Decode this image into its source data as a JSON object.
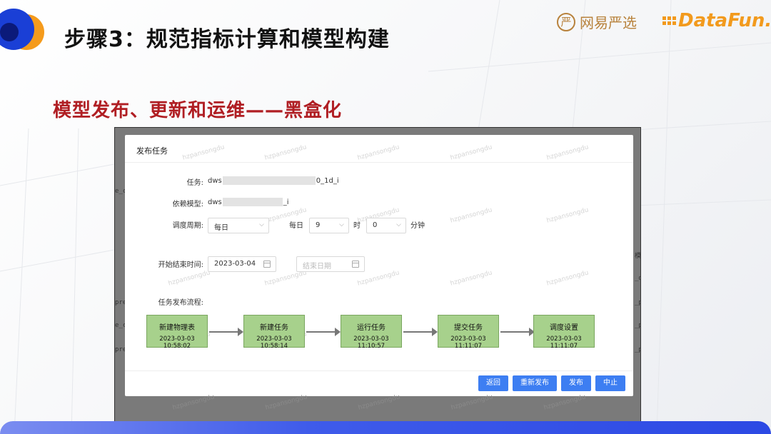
{
  "header": {
    "title": "步骤3：规范指标计算和模型构建",
    "brand_wy": "网易严选",
    "brand_wy_icon": "严",
    "brand_df": "DataFun.",
    "accent_orange": "#f59b1c",
    "accent_blue": "#1a3fd6"
  },
  "subtitle": "模型发布、更新和运维——黑盒化",
  "subtitle_color": "#b01e23",
  "screenshot": {
    "side_texts": [
      "e_c",
      "模",
      "_da",
      "pre",
      "_p",
      "e_c",
      "_p",
      "pre",
      "_p"
    ],
    "watermark": "hzpansongdu",
    "dialog": {
      "title": "发布任务",
      "fields": {
        "task_label": "任务:",
        "task_prefix": "dws",
        "task_suffix": "0_1d_i",
        "model_label": "依赖模型:",
        "model_prefix": "dws",
        "model_suffix": "_i",
        "period_label": "调度周期:",
        "period_value": "每日",
        "daily_label": "每日",
        "hour_value": "9",
        "hour_label": "时",
        "minute_value": "0",
        "minute_label": "分钟",
        "date_label": "开始结束时间:",
        "start_date": "2023-03-04",
        "end_date_placeholder": "结束日期",
        "flow_label": "任务发布流程:"
      },
      "flow": [
        {
          "name": "新建物理表",
          "time": "2023-03-03 10:58:02"
        },
        {
          "name": "新建任务",
          "time": "2023-03-03 10:58:14"
        },
        {
          "name": "运行任务",
          "time": "2023-03-03 11:10:57"
        },
        {
          "name": "提交任务",
          "time": "2023-03-03 11:11:07"
        },
        {
          "name": "调度设置",
          "time": "2023-03-03 11:11:07"
        }
      ],
      "buttons": {
        "back": "返回",
        "republish": "重新发布",
        "publish": "发布",
        "stop": "中止"
      },
      "button_color": "#3d7ef2",
      "flow_color": "#a7d18c",
      "chevron_glyph": "⌵"
    }
  }
}
